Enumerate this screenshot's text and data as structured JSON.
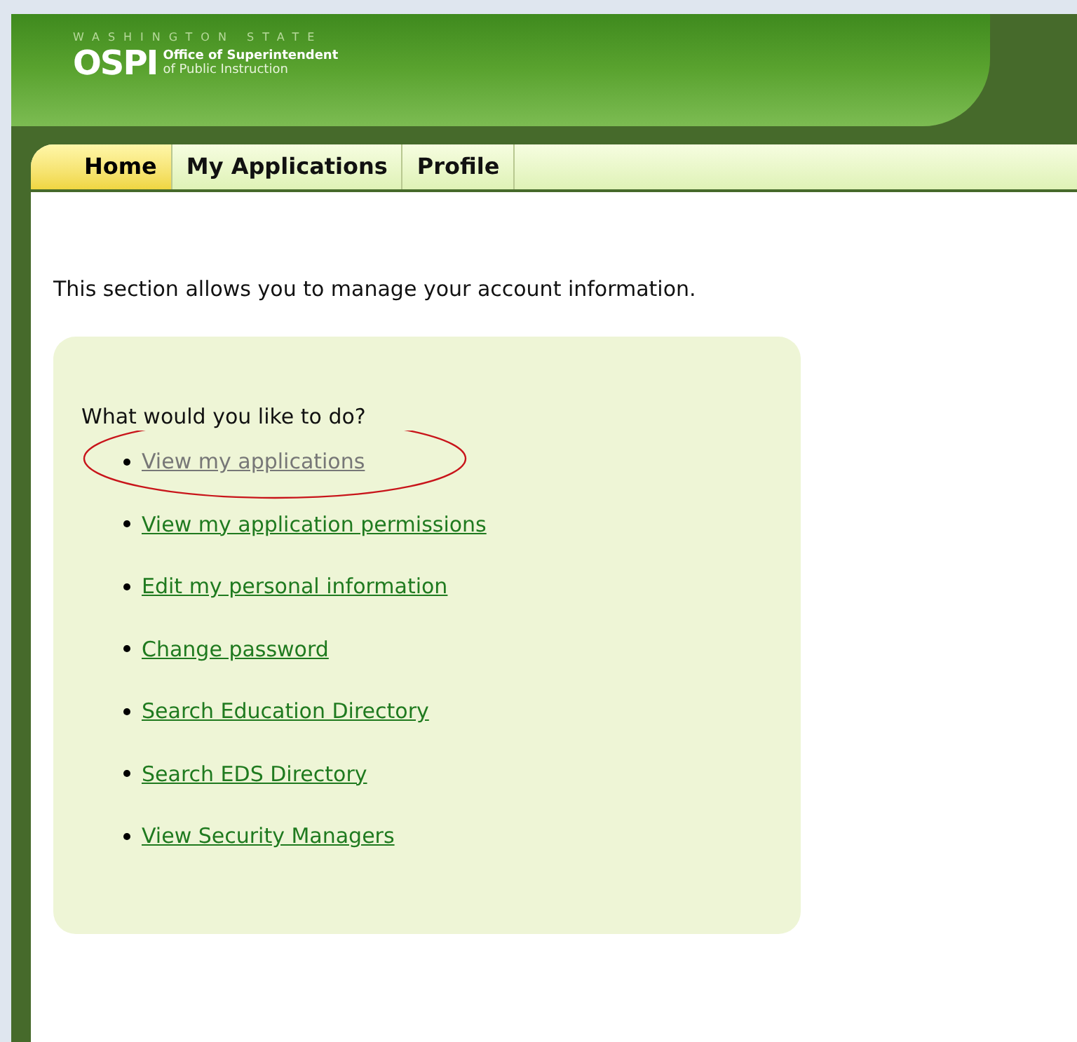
{
  "header": {
    "state_line": "WASHINGTON STATE",
    "logo_mark": "OSPI",
    "agency_line_1": "Office of Superintendent",
    "agency_line_2": "of Public Instruction"
  },
  "tabs": [
    {
      "label": "Home",
      "selected": true
    },
    {
      "label": "My Applications",
      "selected": false
    },
    {
      "label": "Profile",
      "selected": false
    }
  ],
  "intro": "This section allows you to manage your account information.",
  "panel": {
    "question": "What would you like to do?",
    "links": [
      {
        "label": "View my applications",
        "visited": true,
        "circled": true
      },
      {
        "label": "View my application permissions",
        "visited": false,
        "circled": false
      },
      {
        "label": "Edit my personal information",
        "visited": false,
        "circled": false
      },
      {
        "label": "Change password",
        "visited": false,
        "circled": false
      },
      {
        "label": "Search Education Directory",
        "visited": false,
        "circled": false
      },
      {
        "label": "Search EDS Directory",
        "visited": false,
        "circled": false
      },
      {
        "label": "View Security Managers",
        "visited": false,
        "circled": false
      }
    ]
  }
}
